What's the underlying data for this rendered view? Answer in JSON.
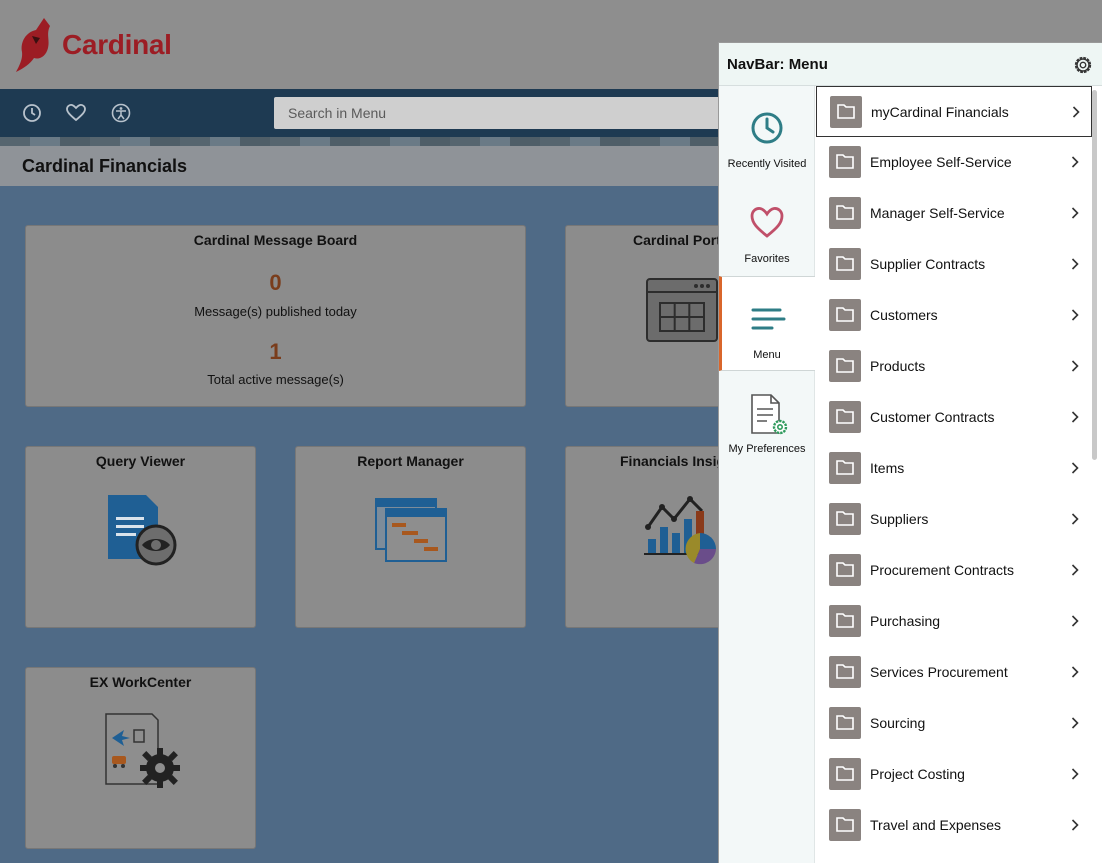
{
  "brand": {
    "name": "Cardinal"
  },
  "toolbar": {
    "recent_icon": "clock-icon",
    "favorites_icon": "heart-icon",
    "accessibility_icon": "accessibility-icon",
    "search_placeholder": "Search in Menu"
  },
  "page": {
    "title": "Cardinal Financials"
  },
  "tiles": {
    "message_board": {
      "title": "Cardinal Message Board",
      "published_count": "0",
      "published_label": "Message(s) published today",
      "active_count": "1",
      "active_label": "Total active message(s)"
    },
    "portal": {
      "title": "Cardinal Port"
    },
    "query_viewer": {
      "title": "Query Viewer"
    },
    "report_manager": {
      "title": "Report Manager"
    },
    "financials_insights": {
      "title": "Financials Insig"
    },
    "ex_workcenter": {
      "title": "EX WorkCenter"
    }
  },
  "nav": {
    "title": "NavBar: Menu",
    "settings_icon": "gear-icon",
    "rail": [
      {
        "label": "Recently Visited",
        "icon": "clock-icon"
      },
      {
        "label": "Favorites",
        "icon": "heart-icon"
      },
      {
        "label": "Menu",
        "icon": "menu-icon",
        "active": true
      },
      {
        "label": "My Preferences",
        "icon": "preferences-icon"
      }
    ],
    "items": [
      {
        "label": "myCardinal Financials"
      },
      {
        "label": "Employee Self-Service"
      },
      {
        "label": "Manager Self-Service"
      },
      {
        "label": "Supplier Contracts"
      },
      {
        "label": "Customers"
      },
      {
        "label": "Products"
      },
      {
        "label": "Customer Contracts"
      },
      {
        "label": "Items"
      },
      {
        "label": "Suppliers"
      },
      {
        "label": "Procurement Contracts"
      },
      {
        "label": "Purchasing"
      },
      {
        "label": "Services Procurement"
      },
      {
        "label": "Sourcing"
      },
      {
        "label": "Project Costing"
      },
      {
        "label": "Travel and Expenses"
      }
    ]
  },
  "colors": {
    "brand_red": "#9c1d24",
    "accent_teal": "#2e7d86",
    "active_orange": "#d9662b"
  }
}
